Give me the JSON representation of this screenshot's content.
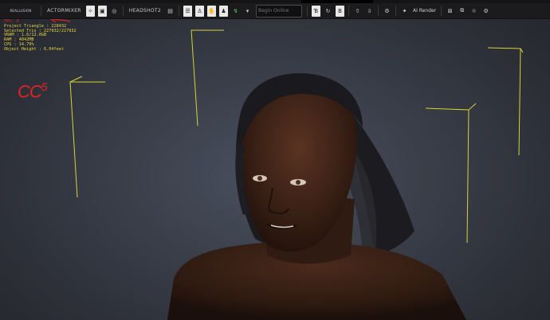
{
  "app": {
    "accent": "#e8d444",
    "annotation_color": "#e02424",
    "toolbar_bg": "#1b1b1d"
  },
  "toolbar": {
    "logo_text": "REALLUSION",
    "actormixer_label": "ACTORMIXER",
    "headshot_label": "HEADSHOT2",
    "search_placeholder": "Begin Online",
    "airender_label": "AI Render",
    "icons": [
      "settings-icon",
      "motion-icon",
      "smart-icon",
      "headshot-icon",
      "video-icon",
      "character-icon",
      "body-icon",
      "hand-icon",
      "bolt-icon",
      "search-icon",
      "stylize-icon",
      "refresh-icon",
      "text-icon",
      "upload-icon",
      "download-icon",
      "gear-icon",
      "ai-render-icon",
      "window-icon",
      "duplicate-icon",
      "target-icon",
      "close-icon"
    ]
  },
  "stats": {
    "fps": "FPS: 0",
    "project_triangle": "Project Triangle : 228432",
    "selected_tris": "Selected Tris : 227932/227932",
    "vram": "VRAM : 1.6/12.0GB",
    "ram": "RAM : 4042MB",
    "cpu": "CPU : 14.79%",
    "object_height": "Object Height : 6.04feet"
  },
  "annotation": {
    "text": "CC",
    "superscript": "5"
  }
}
